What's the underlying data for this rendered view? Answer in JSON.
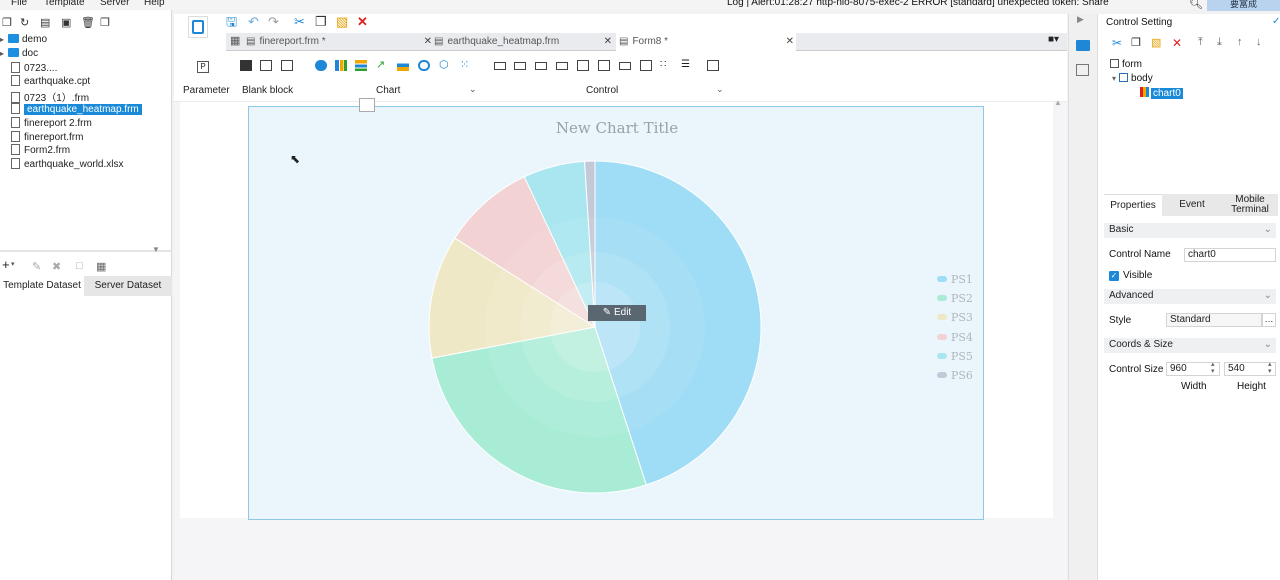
{
  "menu": {
    "items": [
      "File",
      "Template",
      "Server",
      "Help"
    ]
  },
  "status_text": "Log | Alert:01:28:27 http-nio-8075-exec-2 ERROR [standard] unexpected token: Share",
  "user_button": "要富成",
  "file_tree": [
    {
      "label": "demo",
      "type": "folder"
    },
    {
      "label": "doc",
      "type": "folder"
    },
    {
      "label": "0723....",
      "type": "file"
    },
    {
      "label": "earthquake.cpt",
      "type": "file"
    },
    {
      "label": "0723（1）.frm",
      "type": "file"
    },
    {
      "label": "earthquake_heatmap.frm",
      "type": "file",
      "selected": true
    },
    {
      "label": "finereport 2.frm",
      "type": "file"
    },
    {
      "label": "finereport.frm",
      "type": "file"
    },
    {
      "label": "Form2.frm",
      "type": "file"
    },
    {
      "label": "earthquake_world.xlsx",
      "type": "file"
    }
  ],
  "dataset_tabs": [
    "Template Dataset",
    "Server Dataset"
  ],
  "doc_tabs": [
    {
      "label": "finereport.frm *"
    },
    {
      "label": "earthquake_heatmap.frm"
    },
    {
      "label": "Form8 *"
    }
  ],
  "widget_groups": {
    "parameter": "Parameter",
    "blank_block": "Blank block",
    "chart": "Chart",
    "control": "Control"
  },
  "chart_data": {
    "type": "pie",
    "title": "New Chart Title",
    "legend_position": "right",
    "series": [
      {
        "name": "PS1",
        "value": 45,
        "color": "#9fdcf5"
      },
      {
        "name": "PS2",
        "value": 27,
        "color": "#a8ecd6"
      },
      {
        "name": "PS3",
        "value": 12,
        "color": "#efe8c6"
      },
      {
        "name": "PS4",
        "value": 9,
        "color": "#f2d2d2"
      },
      {
        "name": "PS5",
        "value": 6,
        "color": "#a9e6ef"
      },
      {
        "name": "PS6",
        "value": 1,
        "color": "#c3c9d6"
      }
    ]
  },
  "edit_button": "Edit",
  "control_setting": {
    "title": "Control Setting",
    "tree": [
      "form",
      "body",
      "chart0"
    ],
    "tabs": [
      "Properties",
      "Event",
      "Mobile Terminal"
    ],
    "basic_label": "Basic",
    "control_name_label": "Control Name",
    "control_name_value": "chart0",
    "visible_label": "Visible",
    "advanced_label": "Advanced",
    "style_label": "Style",
    "style_value": "Standard",
    "coords_label": "Coords & Size",
    "size_label": "Control Size",
    "width_value": "960",
    "height_value": "540",
    "width_label": "Width",
    "height_label": "Height"
  }
}
